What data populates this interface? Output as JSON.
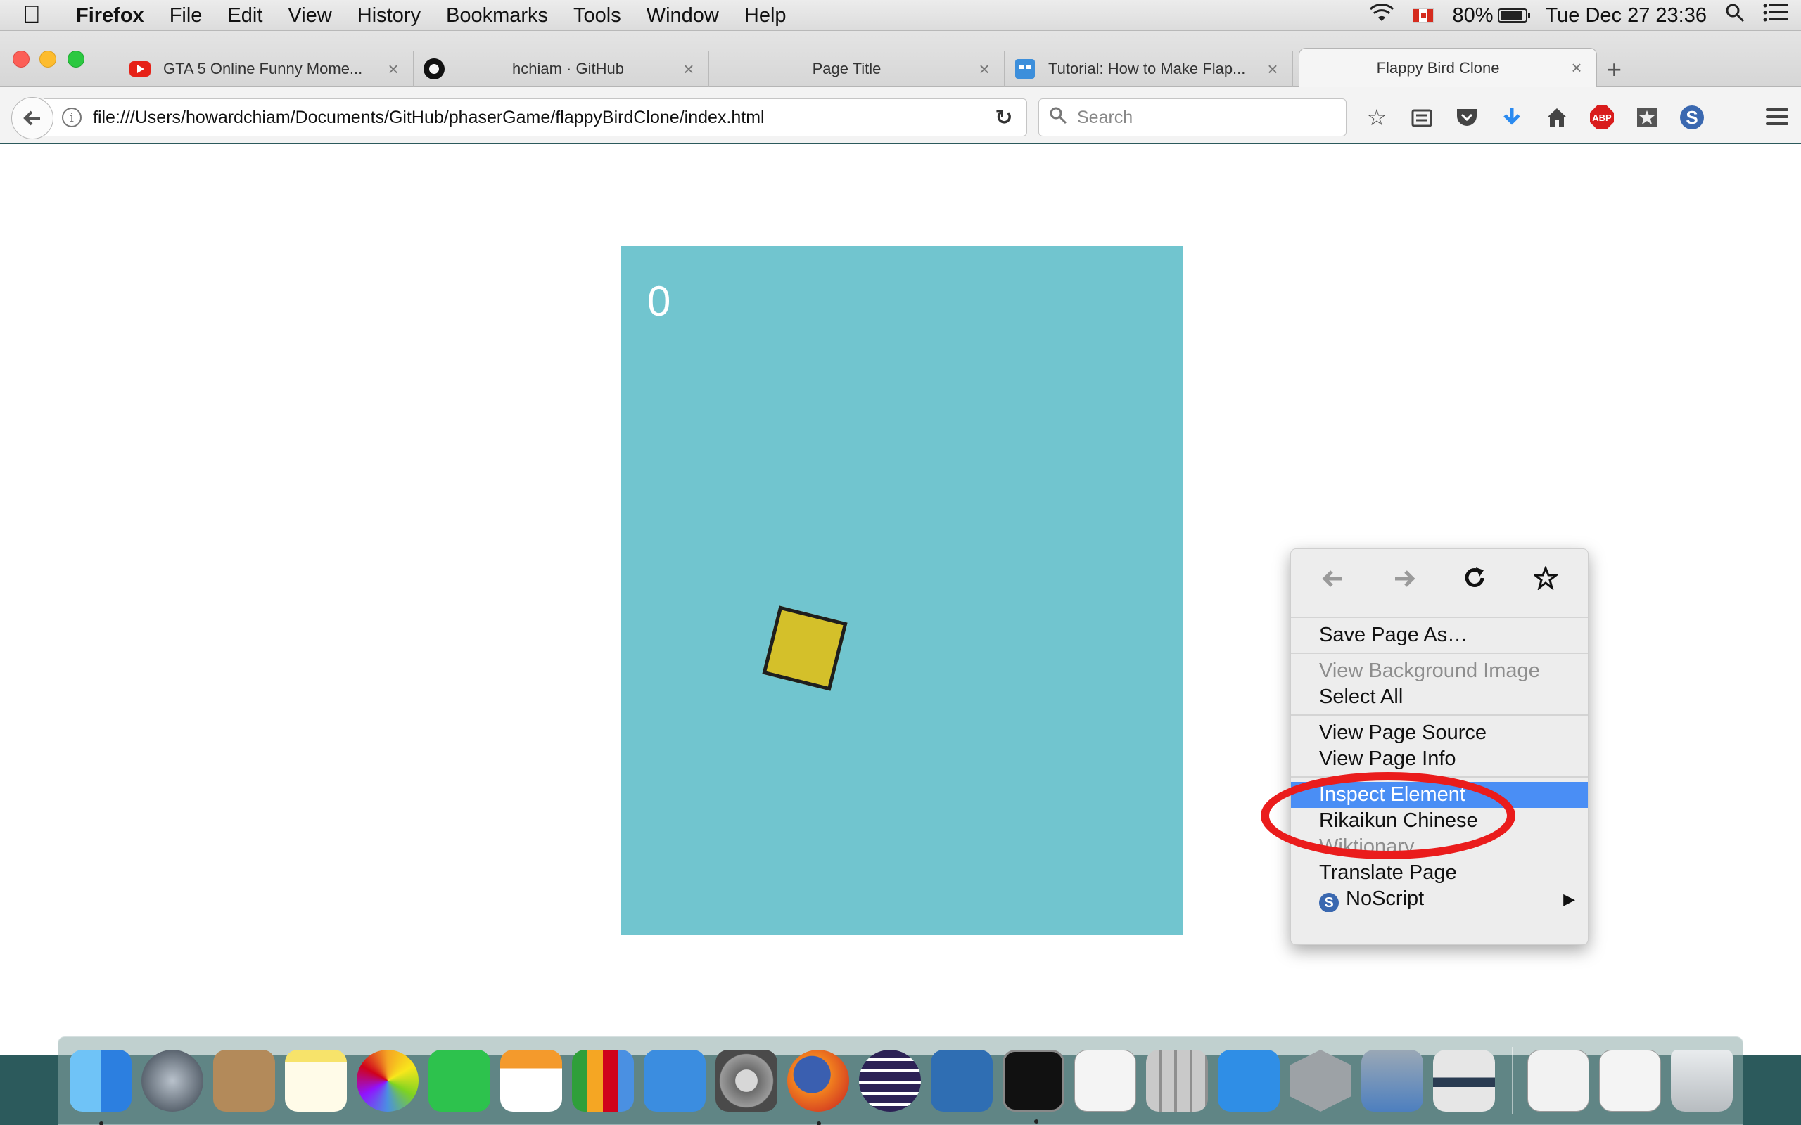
{
  "menubar": {
    "app_name": "Firefox",
    "menus": [
      "File",
      "Edit",
      "View",
      "History",
      "Bookmarks",
      "Tools",
      "Window",
      "Help"
    ],
    "battery": "80%",
    "datetime": "Tue Dec 27  23:36"
  },
  "tabs": [
    {
      "title": "GTA 5 Online Funny Mome...",
      "icon": "youtube-icon"
    },
    {
      "title": "hchiam · GitHub",
      "icon": "github-icon"
    },
    {
      "title": "Page Title",
      "icon": "none"
    },
    {
      "title": "Tutorial: How to Make Flap...",
      "icon": "invader-icon"
    },
    {
      "title": "Flappy Bird Clone",
      "icon": "none",
      "active": true
    }
  ],
  "navbar": {
    "url": "file:///Users/howardchiam/Documents/GitHub/phaserGame/flappyBirdClone/index.html",
    "search_placeholder": "Search"
  },
  "game": {
    "score": "0",
    "background_color": "#71c5cf",
    "bird_color": "#d4c02a"
  },
  "context_menu": {
    "save_page_as": "Save Page As…",
    "view_background_image": "View Background Image",
    "select_all": "Select All",
    "view_page_source": "View Page Source",
    "view_page_info": "View Page Info",
    "inspect_element": "Inspect Element",
    "rikaikun": "Rikaikun Chinese",
    "wiktionary": "Wiktionary",
    "translate_page": "Translate Page",
    "noscript": "NoScript"
  },
  "annotation": {
    "circle_color": "#ea1c1c"
  },
  "dock": {
    "apps": [
      "finder",
      "launchpad",
      "contacts",
      "notes",
      "photos",
      "facetime",
      "pages",
      "numbers",
      "keynote",
      "system-preferences",
      "firefox",
      "eclipse",
      "virtualbox",
      "terminal",
      "textedit",
      "calculator",
      "xcode",
      "sequel-pro",
      "network-utility",
      "asana",
      "preview",
      "firefox-download",
      "trash"
    ]
  }
}
